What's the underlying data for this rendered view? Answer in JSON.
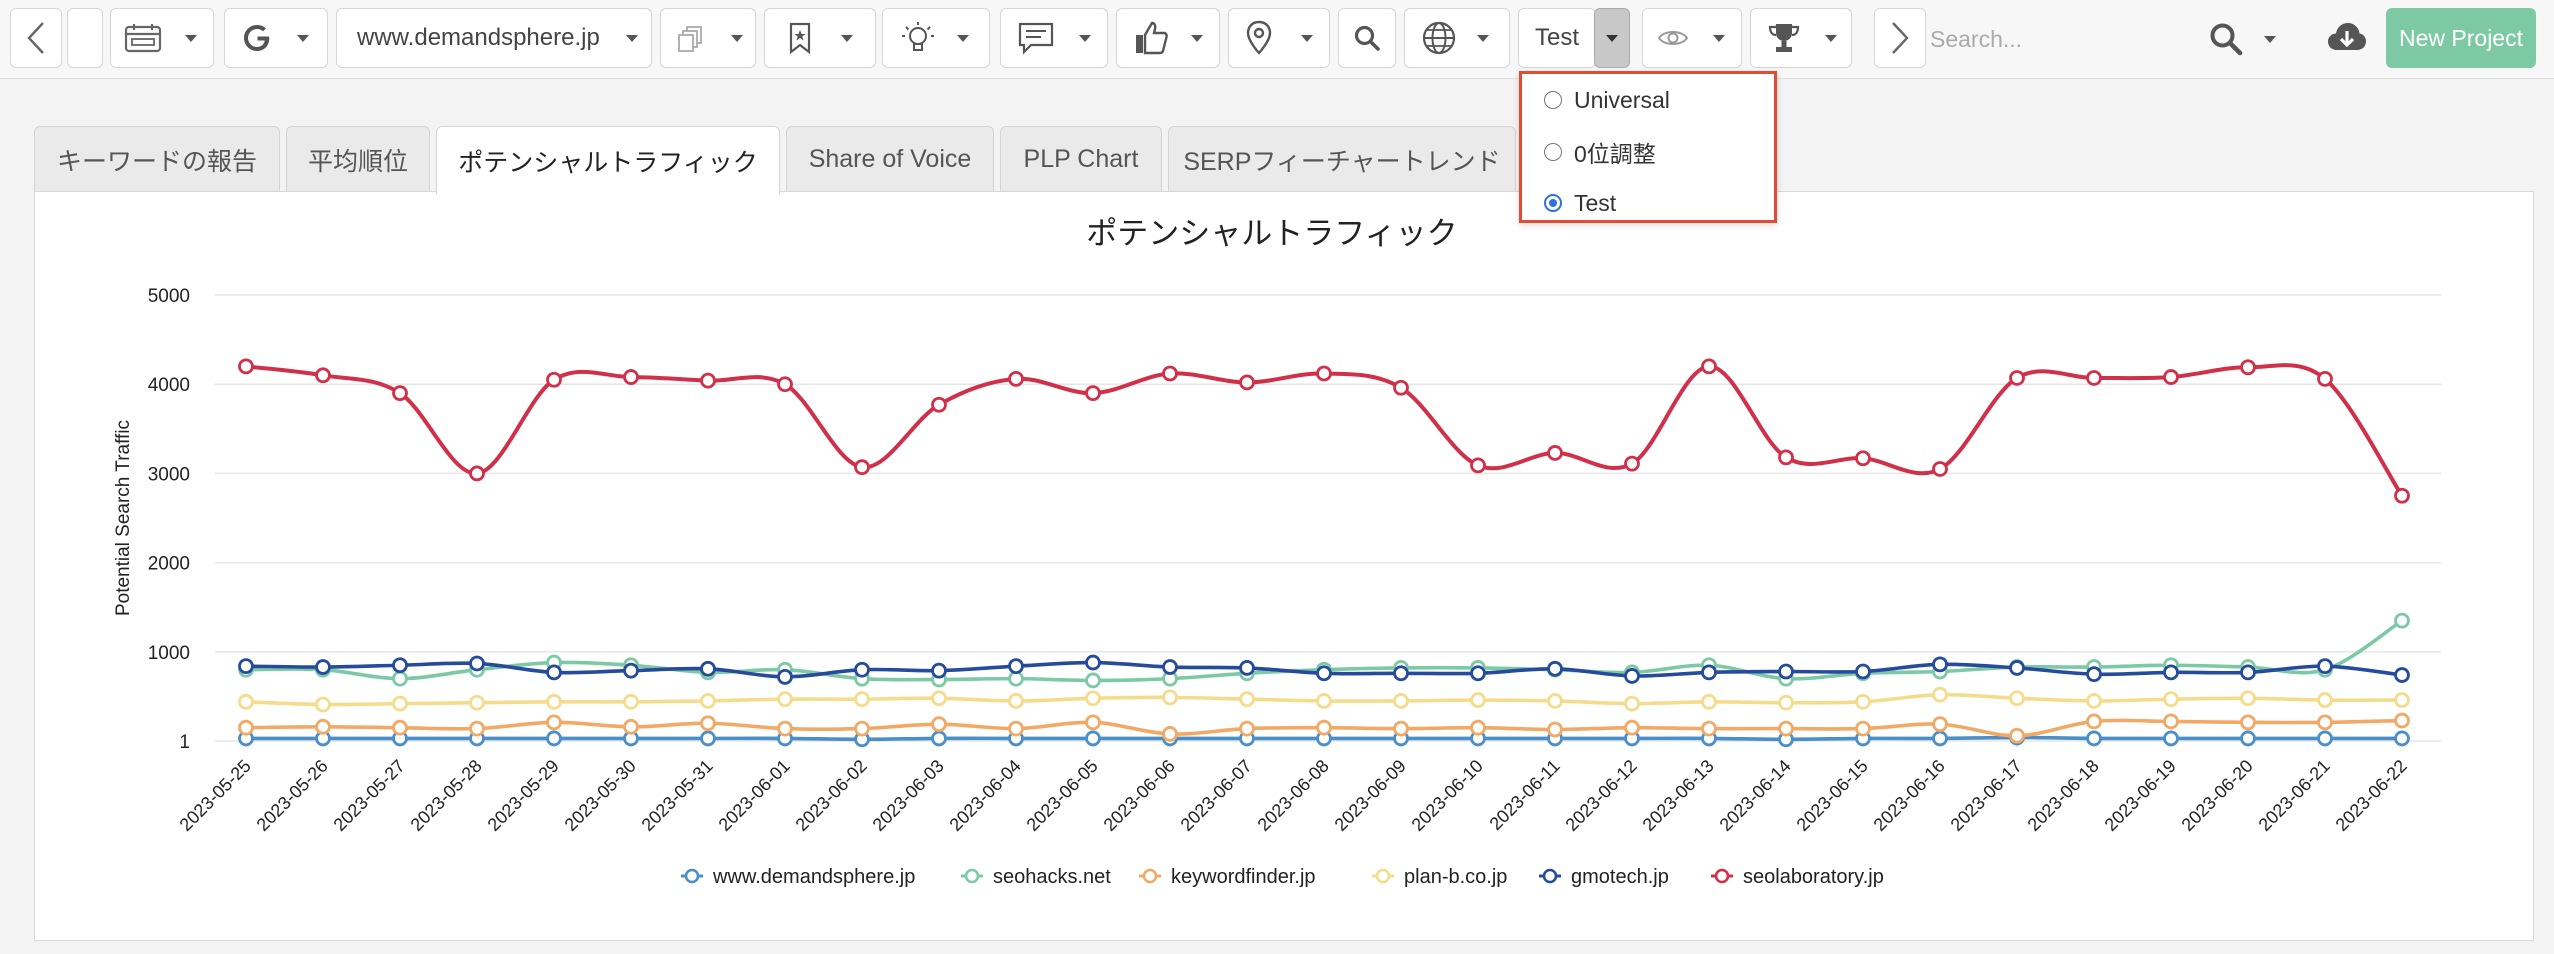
{
  "toolbar": {
    "domain": "www.demandsphere.jp",
    "view_select": "Test",
    "search_placeholder": "Search...",
    "new_project": "New Project"
  },
  "dropdown": {
    "options": [
      {
        "label": "Universal",
        "checked": false
      },
      {
        "label": "0位調整",
        "checked": false
      },
      {
        "label": "Test",
        "checked": true
      }
    ]
  },
  "tabs": [
    {
      "label": "キーワードの報告"
    },
    {
      "label": "平均順位"
    },
    {
      "label": "ポテンシャルトラフィック"
    },
    {
      "label": "Share of Voice"
    },
    {
      "label": "PLP Chart"
    },
    {
      "label": "SERPフィーチャートレンド"
    }
  ],
  "chart_data": {
    "type": "line",
    "title": "ポテンシャルトラフィック",
    "ylabel": "Potential Search Traffic",
    "xlabel": "",
    "yticks": [
      1,
      1000,
      2000,
      3000,
      4000,
      5000
    ],
    "ylim": [
      1,
      5000
    ],
    "grid": true,
    "legend": "bottom",
    "x": [
      "2023-05-25",
      "2023-05-26",
      "2023-05-27",
      "2023-05-28",
      "2023-05-29",
      "2023-05-30",
      "2023-05-31",
      "2023-06-01",
      "2023-06-02",
      "2023-06-03",
      "2023-06-04",
      "2023-06-05",
      "2023-06-06",
      "2023-06-07",
      "2023-06-08",
      "2023-06-09",
      "2023-06-10",
      "2023-06-11",
      "2023-06-12",
      "2023-06-13",
      "2023-06-14",
      "2023-06-15",
      "2023-06-16",
      "2023-06-17",
      "2023-06-18",
      "2023-06-19",
      "2023-06-20",
      "2023-06-21",
      "2023-06-22"
    ],
    "series": [
      {
        "name": "www.demandsphere.jp",
        "color": "#4a8fc9",
        "values": [
          30,
          30,
          30,
          30,
          30,
          30,
          30,
          30,
          20,
          30,
          30,
          30,
          30,
          30,
          30,
          30,
          30,
          30,
          30,
          30,
          20,
          30,
          30,
          40,
          30,
          30,
          30,
          30,
          30
        ]
      },
      {
        "name": "seohacks.net",
        "color": "#7cc9a6",
        "values": [
          800,
          800,
          700,
          800,
          880,
          850,
          770,
          800,
          700,
          690,
          700,
          680,
          700,
          760,
          800,
          820,
          820,
          800,
          770,
          850,
          700,
          760,
          780,
          830,
          830,
          850,
          830,
          800,
          1350
        ]
      },
      {
        "name": "keywordfinder.jp",
        "color": "#f2a966",
        "values": [
          150,
          160,
          150,
          140,
          210,
          160,
          200,
          140,
          140,
          190,
          140,
          210,
          80,
          140,
          150,
          140,
          150,
          130,
          150,
          140,
          140,
          140,
          190,
          60,
          220,
          220,
          210,
          210,
          230
        ]
      },
      {
        "name": "plan-b.co.jp",
        "color": "#f5dc8c",
        "values": [
          440,
          410,
          420,
          430,
          440,
          440,
          450,
          470,
          470,
          480,
          450,
          480,
          490,
          470,
          450,
          450,
          460,
          450,
          420,
          440,
          430,
          440,
          520,
          480,
          450,
          470,
          480,
          460,
          460
        ]
      },
      {
        "name": "gmotech.jp",
        "color": "#274b9c",
        "values": [
          840,
          830,
          850,
          870,
          770,
          790,
          810,
          720,
          800,
          790,
          840,
          880,
          830,
          820,
          760,
          760,
          760,
          810,
          730,
          770,
          780,
          780,
          860,
          820,
          750,
          770,
          770,
          840,
          740
        ]
      },
      {
        "name": "seolaboratory.jp",
        "color": "#d0304a",
        "values": [
          4200,
          4100,
          3900,
          3000,
          4050,
          4080,
          4040,
          4000,
          3070,
          3770,
          4060,
          3900,
          4120,
          4020,
          4120,
          3960,
          3090,
          3230,
          3110,
          4200,
          3180,
          3170,
          3050,
          4070,
          4070,
          4080,
          4190,
          4060,
          2750
        ]
      }
    ]
  }
}
